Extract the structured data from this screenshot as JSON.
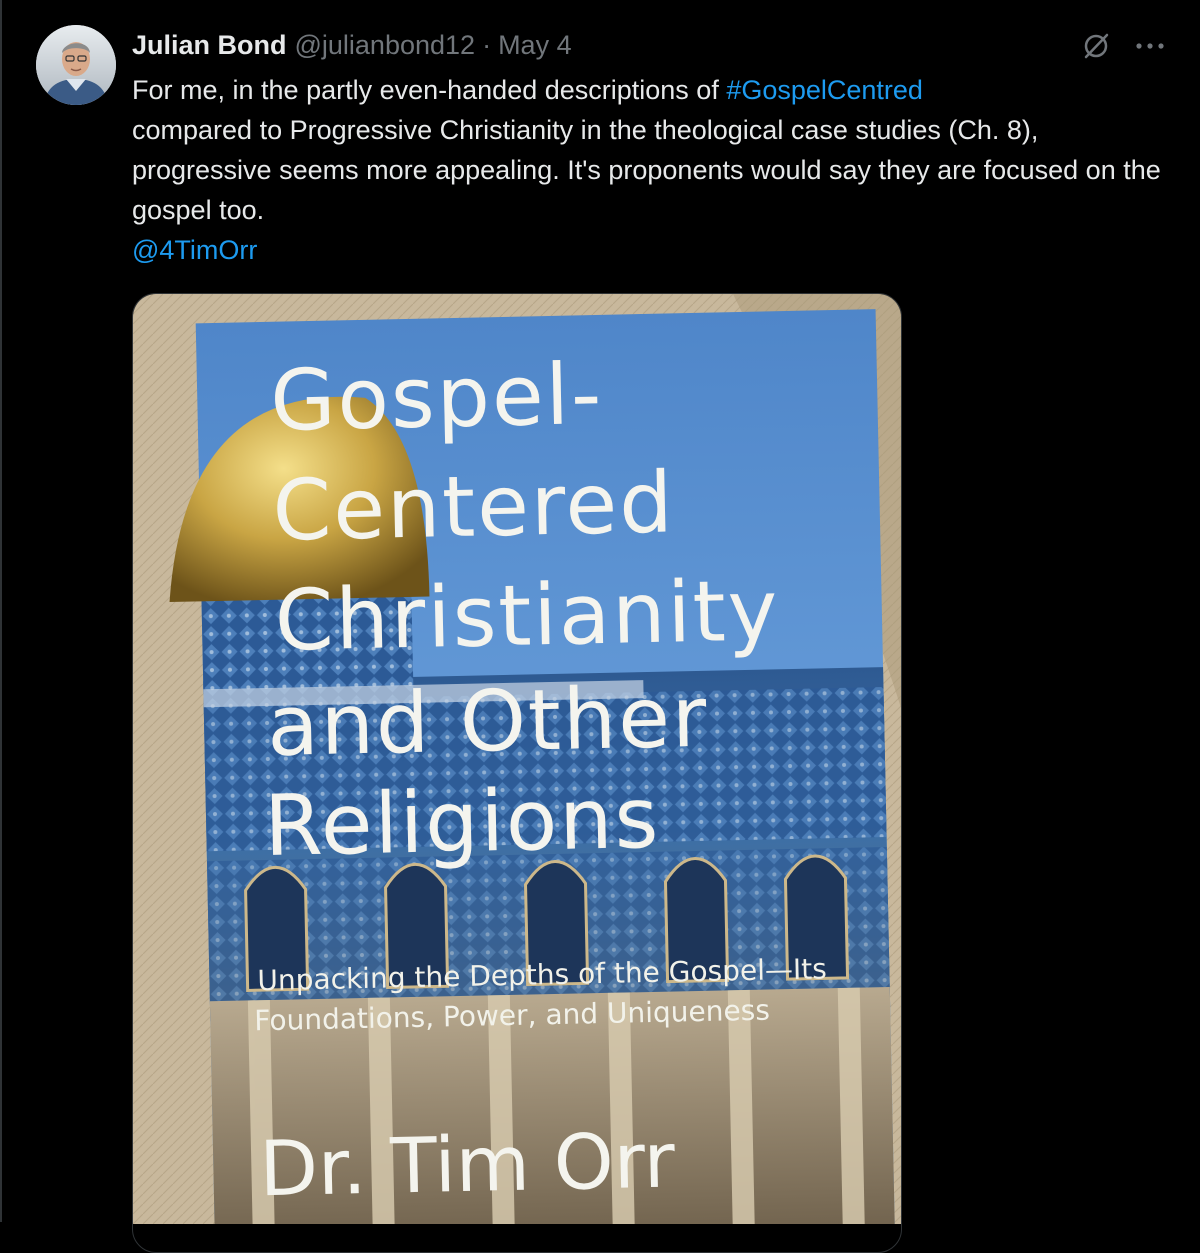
{
  "tweet": {
    "author": {
      "display_name": "Julian Bond",
      "handle": "@julianbond12",
      "avatar_icon": "avatar-photo"
    },
    "separator": "·",
    "date": "May 4",
    "text": {
      "part1": "For me, in the partly even-handed descriptions of ",
      "hashtag": "#GospelCentred",
      "part2": "compared to Progressive Christianity in the theological case studies (Ch. 8), progressive seems more appealing. It's proponents would say they are focused on the gospel too.",
      "mention": "@4TimOrr"
    },
    "icons": {
      "grok": "grok-icon",
      "more": "more-icon"
    },
    "colors": {
      "background": "#000000",
      "text": "#e7e9ea",
      "muted": "#71767b",
      "link": "#1d9bf0"
    },
    "media": {
      "book_title_lines": [
        "Gospel-",
        "Centered",
        "Christianity",
        "and Other",
        "Religions"
      ],
      "book_subtitle_lines": [
        "Unpacking the Depths of the Gospel—Its",
        "Foundations, Power, and Uniqueness"
      ],
      "book_author": "Dr. Tim Orr"
    }
  }
}
